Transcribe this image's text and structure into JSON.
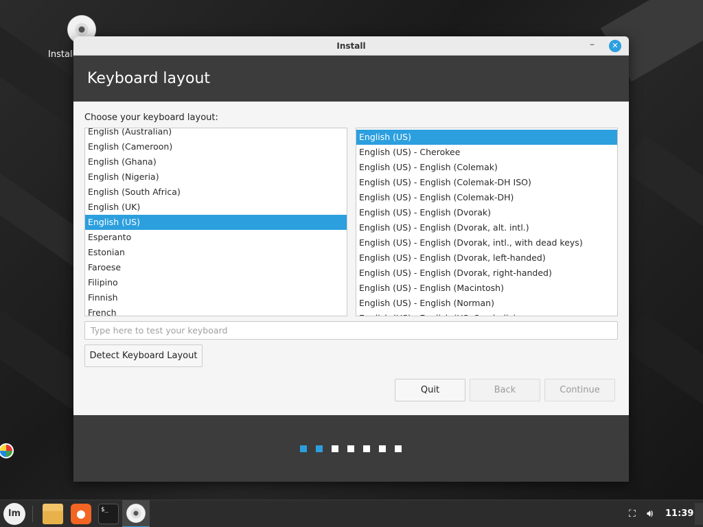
{
  "desktop": {
    "icon_label": "Install"
  },
  "window": {
    "title": "Install",
    "minimize_glyph": "–",
    "close_glyph": "✕",
    "heading": "Keyboard layout"
  },
  "content": {
    "choose_label": "Choose your keyboard layout:",
    "layouts": [
      "English (Australian)",
      "English (Cameroon)",
      "English (Ghana)",
      "English (Nigeria)",
      "English (South Africa)",
      "English (UK)",
      "English (US)",
      "Esperanto",
      "Estonian",
      "Faroese",
      "Filipino",
      "Finnish",
      "French"
    ],
    "selected_layout": "English (US)",
    "variants": [
      "English (US)",
      "English (US) - Cherokee",
      "English (US) - English (Colemak)",
      "English (US) - English (Colemak-DH ISO)",
      "English (US) - English (Colemak-DH)",
      "English (US) - English (Dvorak)",
      "English (US) - English (Dvorak, alt. intl.)",
      "English (US) - English (Dvorak, intl., with dead keys)",
      "English (US) - English (Dvorak, left-handed)",
      "English (US) - English (Dvorak, right-handed)",
      "English (US) - English (Macintosh)",
      "English (US) - English (Norman)",
      "English (US) - English (US, Symbolic)"
    ],
    "selected_variant": "English (US)",
    "test_placeholder": "Type here to test your keyboard",
    "detect_button": "Detect Keyboard Layout",
    "quit_button": "Quit",
    "back_button": "Back",
    "continue_button": "Continue"
  },
  "progress": {
    "total_steps": 7,
    "completed_steps": 2
  },
  "taskbar": {
    "menu_icon": "linux-mint-menu-icon",
    "apps": [
      "files-folder-icon",
      "firefox-icon",
      "terminal-icon",
      "install-disc-icon"
    ],
    "terminal_glyph": "$_",
    "clock": "11:39"
  },
  "colors": {
    "accent": "#2c9fdf",
    "window_dark": "#3c3c3c",
    "content_bg": "#f5f5f5"
  }
}
